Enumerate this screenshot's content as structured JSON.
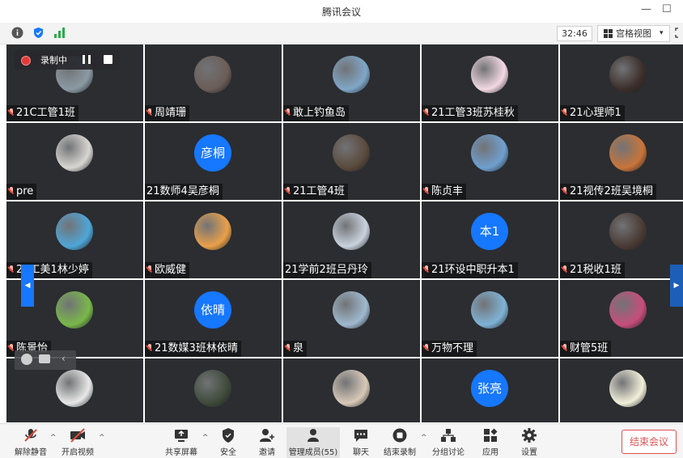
{
  "window": {
    "title": "腾讯会议",
    "minimize_glyph": "—",
    "maximize_glyph": "☐"
  },
  "toolbar": {
    "timer": "32:46",
    "view_label": "宫格视图",
    "view_caret": "▾"
  },
  "recording": {
    "label": "录制中"
  },
  "participants": [
    {
      "name": "21C工管1班",
      "muted": true,
      "avatar": "photo",
      "avatar_color": "#8a9aa3"
    },
    {
      "name": "周靖珊",
      "muted": true,
      "avatar": "photo",
      "avatar_color": "#6b5d57"
    },
    {
      "name": "敢上钓鱼岛",
      "muted": true,
      "avatar": "photo",
      "avatar_color": "#7fa7c8"
    },
    {
      "name": "21工管3班苏桂秋",
      "muted": true,
      "avatar": "photo",
      "avatar_color": "#f3d9e3"
    },
    {
      "name": "21心理师1",
      "muted": true,
      "avatar": "photo",
      "avatar_color": "#3c2e2a"
    },
    {
      "name": "pre",
      "muted": true,
      "avatar": "photo",
      "avatar_color": "#d8d6d2"
    },
    {
      "name": "21数师4吴彦桐",
      "muted": false,
      "avatar": "text",
      "avatar_text": "彦桐"
    },
    {
      "name": "21工管4班",
      "muted": true,
      "avatar": "photo",
      "avatar_color": "#5a4a3c"
    },
    {
      "name": "陈贞丰",
      "muted": true,
      "avatar": "photo",
      "avatar_color": "#6f9fcf"
    },
    {
      "name": "21视传2班吴境桐",
      "muted": true,
      "avatar": "photo",
      "avatar_color": "#c8743a"
    },
    {
      "name": "21工美1林少婷",
      "muted": true,
      "avatar": "photo",
      "avatar_color": "#4fa6d8"
    },
    {
      "name": "欧威健",
      "muted": true,
      "avatar": "photo",
      "avatar_color": "#e9a04a"
    },
    {
      "name": "21学前2班吕丹玲",
      "muted": false,
      "avatar": "photo",
      "avatar_color": "#c9d2de"
    },
    {
      "name": "21环设中职升本1",
      "muted": true,
      "avatar": "text",
      "avatar_text": "本1"
    },
    {
      "name": "21税收1班",
      "muted": true,
      "avatar": "photo",
      "avatar_color": "#4a3a33"
    },
    {
      "name": "陈景怡",
      "muted": true,
      "avatar": "photo",
      "avatar_color": "#79b84a"
    },
    {
      "name": "21数媒3班林依晴",
      "muted": true,
      "avatar": "text",
      "avatar_text": "依晴"
    },
    {
      "name": "泉",
      "muted": true,
      "avatar": "photo",
      "avatar_color": "#9fb9cf"
    },
    {
      "name": "万物不理",
      "muted": true,
      "avatar": "photo",
      "avatar_color": "#7fb3d6"
    },
    {
      "name": "财管5班",
      "muted": true,
      "avatar": "photo",
      "avatar_color": "#c64e7a"
    },
    {
      "name": "",
      "muted": false,
      "avatar": "photo",
      "avatar_color": "#e8e8e8"
    },
    {
      "name": "",
      "muted": false,
      "avatar": "photo",
      "avatar_color": "#3e4a3a"
    },
    {
      "name": "",
      "muted": false,
      "avatar": "photo",
      "avatar_color": "#d8c9b8"
    },
    {
      "name": "",
      "muted": false,
      "avatar": "text",
      "avatar_text": "张亮"
    },
    {
      "name": "",
      "muted": false,
      "avatar": "photo",
      "avatar_color": "#f2f0da"
    }
  ],
  "bottombar": {
    "unmute": "解除静音",
    "start_video": "开启视频",
    "share_screen": "共享屏幕",
    "security": "安全",
    "invite": "邀请",
    "manage_members": "管理成员(55)",
    "chat": "聊天",
    "end_recording": "结束录制",
    "breakout": "分组讨论",
    "apps": "应用",
    "settings": "设置",
    "end_meeting": "结束会议"
  },
  "colors": {
    "accent": "#1677ff",
    "danger": "#e05252",
    "tile_bg": "#2b2d31"
  }
}
